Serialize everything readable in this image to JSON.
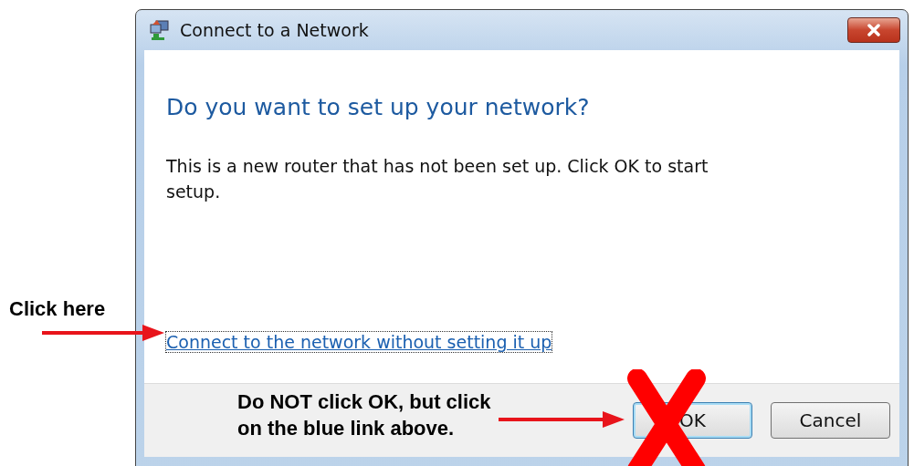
{
  "window": {
    "title": "Connect to a Network"
  },
  "heading": "Do you want to set up your network?",
  "message": "This is a new router that has not been set up. Click OK to start setup.",
  "link": "Connect to the network without setting it up",
  "buttons": [
    {
      "label": "OK",
      "kind": "default"
    },
    {
      "label": "Cancel",
      "kind": "normal"
    }
  ],
  "annotations": [
    {
      "kind": "link-callout",
      "text": "Click here"
    },
    {
      "kind": "button-callout",
      "text": "Do NOT click OK, but click\non the blue link above."
    }
  ]
}
